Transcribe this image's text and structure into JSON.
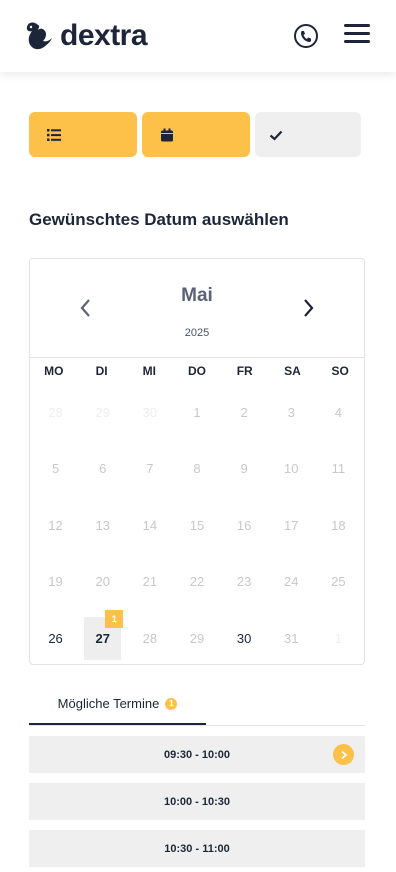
{
  "header": {
    "brand": "dextra"
  },
  "calendar": {
    "title": "Gewünschtes Datum auswählen",
    "month": "Mai",
    "year": "2025",
    "weekdays": [
      "MO",
      "DI",
      "MI",
      "DO",
      "FR",
      "SA",
      "SO"
    ],
    "days": [
      {
        "n": "28",
        "s": "muted"
      },
      {
        "n": "29",
        "s": "muted"
      },
      {
        "n": "30",
        "s": "muted"
      },
      {
        "n": "1",
        "s": "disabled"
      },
      {
        "n": "2",
        "s": "disabled"
      },
      {
        "n": "3",
        "s": "disabled"
      },
      {
        "n": "4",
        "s": "disabled"
      },
      {
        "n": "5",
        "s": "disabled"
      },
      {
        "n": "6",
        "s": "disabled"
      },
      {
        "n": "7",
        "s": "disabled"
      },
      {
        "n": "8",
        "s": "disabled"
      },
      {
        "n": "9",
        "s": "disabled"
      },
      {
        "n": "10",
        "s": "disabled"
      },
      {
        "n": "11",
        "s": "disabled"
      },
      {
        "n": "12",
        "s": "disabled"
      },
      {
        "n": "13",
        "s": "disabled"
      },
      {
        "n": "14",
        "s": "disabled"
      },
      {
        "n": "15",
        "s": "disabled"
      },
      {
        "n": "16",
        "s": "disabled"
      },
      {
        "n": "17",
        "s": "disabled"
      },
      {
        "n": "18",
        "s": "disabled"
      },
      {
        "n": "19",
        "s": "disabled"
      },
      {
        "n": "20",
        "s": "disabled"
      },
      {
        "n": "21",
        "s": "disabled"
      },
      {
        "n": "22",
        "s": "disabled"
      },
      {
        "n": "23",
        "s": "disabled"
      },
      {
        "n": "24",
        "s": "disabled"
      },
      {
        "n": "25",
        "s": "disabled"
      },
      {
        "n": "26",
        "s": "available"
      },
      {
        "n": "27",
        "s": "selected",
        "badge": "1"
      },
      {
        "n": "28",
        "s": "disabled"
      },
      {
        "n": "29",
        "s": "disabled"
      },
      {
        "n": "30",
        "s": "available"
      },
      {
        "n": "31",
        "s": "disabled"
      },
      {
        "n": "1",
        "s": "muted"
      }
    ]
  },
  "tabs": {
    "possible_dates_label": "Mögliche Termine",
    "possible_dates_count": "1"
  },
  "slots": [
    "09:30 - 10:00",
    "10:00 - 10:30",
    "10:30 - 11:00"
  ],
  "colors": {
    "accent": "#fdc14a",
    "text": "#1d2538",
    "inactive": "#efefef"
  },
  "icons": {
    "step1": "list-icon",
    "step2": "calendar-icon",
    "step3": "check-icon",
    "phone": "phone-icon",
    "menu": "hamburger-menu-icon"
  }
}
